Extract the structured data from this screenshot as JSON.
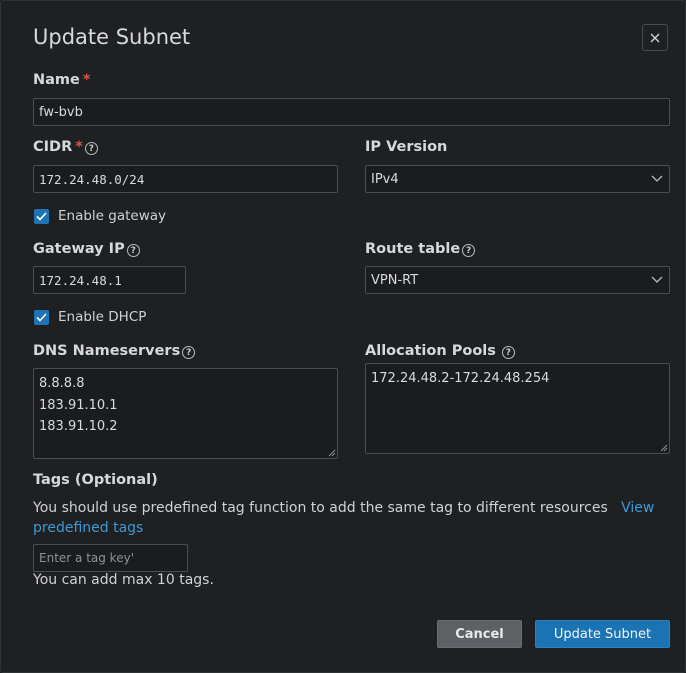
{
  "dialog": {
    "title": "Update Subnet",
    "close_icon": "close-icon"
  },
  "name": {
    "label": "Name",
    "required": "*",
    "value": "fw-bvb"
  },
  "cidr": {
    "label": "CIDR",
    "required": "*",
    "value": "172.24.48.0/24",
    "help_icon": "question-icon"
  },
  "ip_version": {
    "label": "IP Version",
    "value": "IPv4",
    "icon": "chevron-down-icon"
  },
  "enable_gateway": {
    "label": "Enable gateway",
    "checked": true
  },
  "gateway_ip": {
    "label": "Gateway IP",
    "value": "172.24.48.1",
    "help_icon": "question-icon"
  },
  "route_table": {
    "label": "Route table",
    "value": "VPN-RT",
    "icon": "chevron-down-icon"
  },
  "enable_dhcp": {
    "label": "Enable DHCP",
    "checked": true
  },
  "dns": {
    "label": "DNS Nameservers",
    "lines": [
      "8.8.8.8",
      "183.91.10.1",
      "183.91.10.2"
    ]
  },
  "pools": {
    "label": "Allocation Pools",
    "lines": [
      "172.24.48.2-172.24.48.254"
    ]
  },
  "tags": {
    "label": "Tags (Optional)",
    "description": "You should use predefined tag function to add the same tag to different resources",
    "link": "View predefined tags",
    "placeholder": "Enter a tag key'",
    "hint": "You can add max 10 tags."
  },
  "buttons": {
    "cancel": "Cancel",
    "submit": "Update Subnet"
  },
  "colors": {
    "accent": "#1c73b3",
    "link": "#3b9ad9",
    "required": "#e0534f"
  }
}
